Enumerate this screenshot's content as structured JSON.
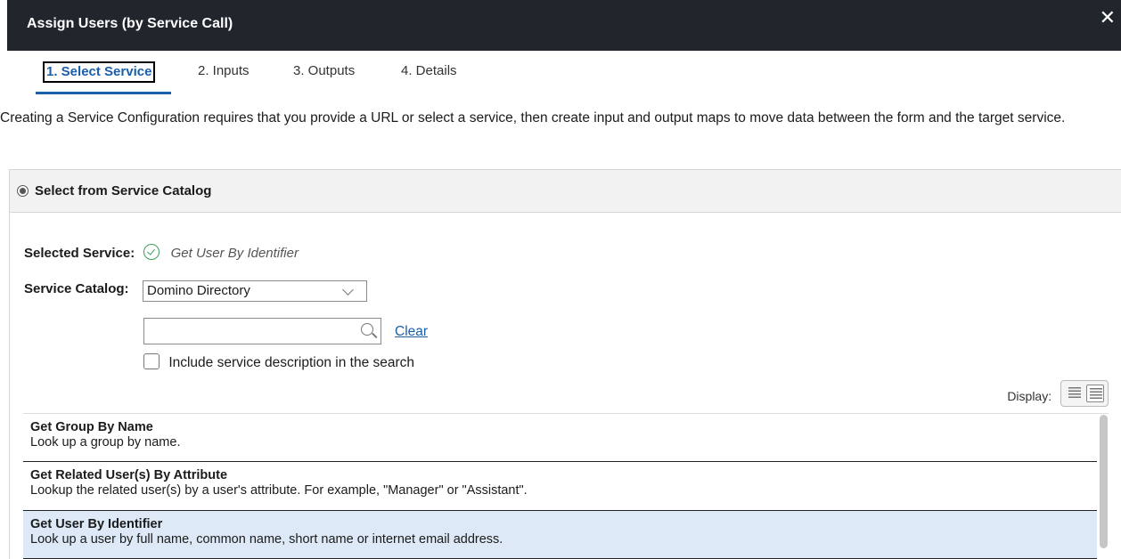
{
  "dialog": {
    "title": "Assign Users (by Service Call)",
    "close_glyph": "✕"
  },
  "tabs": [
    {
      "label": "1. Select Service",
      "active": true
    },
    {
      "label": "2. Inputs",
      "active": false
    },
    {
      "label": "3. Outputs",
      "active": false
    },
    {
      "label": "4. Details",
      "active": false
    }
  ],
  "intro_text": "Creating a Service Configuration requires that you provide a URL or select a service, then create input and output maps to move data between the form and the target service.",
  "panel": {
    "header_label": "Select from Service Catalog",
    "selected_service_label": "Selected Service:",
    "selected_service_value": "Get User By Identifier",
    "catalog_label": "Service Catalog:",
    "catalog_value": "Domino Directory",
    "search_placeholder": "",
    "clear_label": "Clear",
    "include_desc_label": "Include service description in the search",
    "include_desc_checked": false,
    "display_label": "Display:"
  },
  "services": [
    {
      "name": "Get Group By Name",
      "desc": "Look up a group by name.",
      "selected": false
    },
    {
      "name": "Get Related User(s) By Attribute",
      "desc": "Lookup the related user(s) by a user's attribute. For example, \"Manager\" or \"Assistant\".",
      "selected": false
    },
    {
      "name": "Get User By Identifier",
      "desc": "Look up a user by full name, common name, short name or internet email address.",
      "selected": true
    }
  ],
  "colors": {
    "titlebar": "#20262c",
    "accent": "#1a5fa8",
    "selected_row": "#dde9f7",
    "success": "#3f9f5a"
  },
  "icons": [
    "close-icon",
    "radio-selected-icon",
    "check-circle-icon",
    "chevron-down-icon",
    "search-icon",
    "list-view-icon",
    "detail-view-icon"
  ]
}
